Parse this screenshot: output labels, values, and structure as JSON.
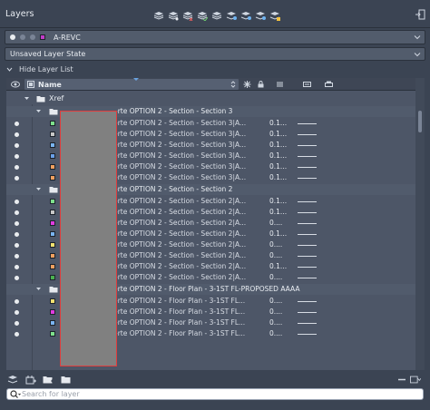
{
  "panel": {
    "title": "Layers"
  },
  "current_layer": {
    "name": "A-REVC",
    "color": "#c23cc8"
  },
  "layer_state": {
    "value": "Unsaved Layer State"
  },
  "toggle": {
    "label": "Hide Layer List"
  },
  "columns": {
    "name": "Name"
  },
  "xref": {
    "label": "Xref"
  },
  "groups": [
    {
      "name": "-rte OPTION 2 - Section - Section 3",
      "layers": [
        {
          "name": "-rte OPTION 2 - Section - Section 3|A...",
          "value": "0.1...",
          "color": "#7ee08c"
        },
        {
          "name": "-rte OPTION 2 - Section - Section 3|A...",
          "value": "0.1...",
          "color": "#c8c8c8"
        },
        {
          "name": "-rte OPTION 2 - Section - Section 3|A...",
          "value": "0.1...",
          "color": "#7ab4f0"
        },
        {
          "name": "-rte OPTION 2 - Section - Section 3|A...",
          "value": "0.1...",
          "color": "#6aa0e8"
        },
        {
          "name": "-rte OPTION 2 - Section - Section 3|A...",
          "value": "0.1...",
          "color": "#f0a060"
        },
        {
          "name": "-rte OPTION 2 - Section - Section 3|A...",
          "value": "0.1...",
          "color": "#f0a060"
        }
      ]
    },
    {
      "name": "-rte OPTION 2 - Section - Section 2",
      "layers": [
        {
          "name": "-rte OPTION 2 - Section - Section 2|A...",
          "value": "0.1...",
          "color": "#7ee08c"
        },
        {
          "name": "-rte OPTION 2 - Section - Section 2|A...",
          "value": "0.1...",
          "color": "#c8c8c8"
        },
        {
          "name": "-rte OPTION 2 - Section - Section 2|A...",
          "value": "0....",
          "color": "#e03ce0"
        },
        {
          "name": "-rte OPTION 2 - Section - Section 2|A...",
          "value": "0.1...",
          "color": "#7ab4f0"
        },
        {
          "name": "-rte OPTION 2 - Section - Section 2|A...",
          "value": "0....",
          "color": "#f0e070"
        },
        {
          "name": "-rte OPTION 2 - Section - Section 2|A...",
          "value": "0....",
          "color": "#f0a060"
        },
        {
          "name": "-rte OPTION 2 - Section - Section 2|A...",
          "value": "0.1...",
          "color": "#f0a060"
        },
        {
          "name": "-rte OPTION 2 - Section - Section 2|A...",
          "value": "0....",
          "color": "#4ab050"
        }
      ]
    },
    {
      "name": "-rte OPTION 2 - Floor Plan - 3-1ST FL-PROPOSED AAAA",
      "layers": [
        {
          "name": "-rte OPTION 2 - Floor Plan - 3-1ST FL...",
          "value": "0....",
          "color": "#f0e070"
        },
        {
          "name": "-rte OPTION 2 - Floor Plan - 3-1ST FL...",
          "value": "0....",
          "color": "#e03ce0"
        },
        {
          "name": "-rte OPTION 2 - Floor Plan - 3-1ST FL...",
          "value": "0....",
          "color": "#7ab4f0"
        },
        {
          "name": "-rte OPTION 2 - Floor Plan - 3-1ST FL...",
          "value": "0....",
          "color": "#7ee08c"
        }
      ]
    }
  ],
  "search": {
    "placeholder": "Search for layer"
  }
}
